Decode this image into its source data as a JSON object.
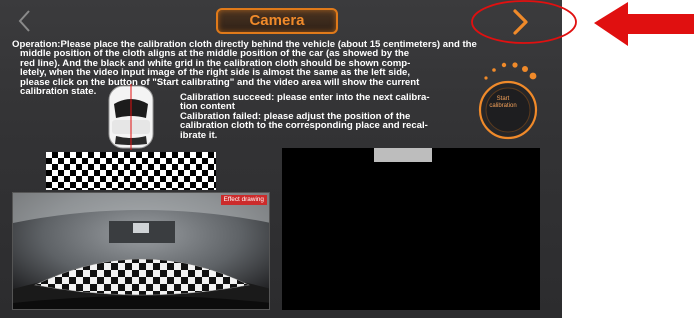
{
  "header": {
    "title": "Camera",
    "back_icon": "chevron-left-icon",
    "next_icon": "chevron-right-icon",
    "accent_color": "#f08a2a"
  },
  "instructions": {
    "line1": "Operation:Please place the calibration cloth directly behind the vehicle (about 15 centimeters) and the",
    "line2": "middle position of the cloth aligns at the middle position of the car (as showed by the",
    "line3": "red line). And the black and white grid in the calibration cloth should be shown comp-",
    "line4": "letely, when the video input image of the right side is almost the same as the left side,",
    "line5": "please click on the button of \"Start calibrating\" and the video area will show the current",
    "line6": "calibration state."
  },
  "calibration_status": {
    "success_line1": "Calibration succeed: please enter into the next calibra-",
    "success_line2": "tion content",
    "fail_line1": "Calibration failed: please adjust the position of the",
    "fail_line2": "calibration cloth to the corresponding place and recal-",
    "fail_line3": "ibrate it."
  },
  "start_button": {
    "label_line1": "Start",
    "label_line2": "calibration"
  },
  "left_video": {
    "badge": "Effect drawing"
  },
  "annotation": {
    "color": "#e01010"
  }
}
